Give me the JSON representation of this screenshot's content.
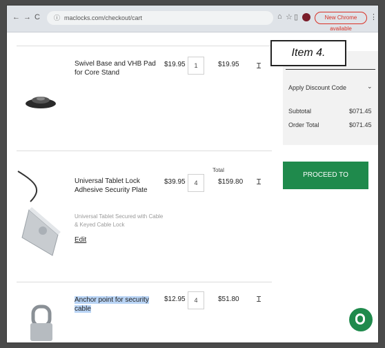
{
  "browser": {
    "url": "maclocks.com/checkout/cart",
    "update_label": "New Chrome available",
    "back": "←",
    "forward": "→",
    "reload": "C",
    "star_icon": "☆",
    "ext_icon": "⌂",
    "sidebar_icon": "▯",
    "menu_icon": "⋮"
  },
  "cart": {
    "items": [
      {
        "name": "Swivel Base and VHB Pad for Core Stand",
        "price": "$19.95",
        "qty": "1",
        "total": "$19.95",
        "remove": "Ɪ"
      },
      {
        "name": "Universal Tablet Lock Adhesive Security Plate",
        "price": "$39.95",
        "qty": "4",
        "total_label": "Total",
        "total": "$159.80",
        "remove": "Ɪ",
        "sub1": "Universal Tablet Secured with Cable",
        "sub2": "& Keyed Cable Lock",
        "edit": "Edit"
      },
      {
        "name": "Anchor point for security cable",
        "price": "$12.95",
        "qty": "4",
        "total": "$51.80",
        "remove": "Ɪ"
      }
    ]
  },
  "summary": {
    "discount_label": "Apply Discount Code",
    "chevron": "⌄",
    "subtotal_label": "Subtotal",
    "subtotal_value": "$071.45",
    "order_total_label": "Order Total",
    "order_total_value": "$071.45"
  },
  "checkout_label": "PROCEED TO CHECKOUT",
  "callout": "Item 4.",
  "colors": {
    "accent": "#1f8a4c",
    "highlight": "#b9d4f5"
  }
}
